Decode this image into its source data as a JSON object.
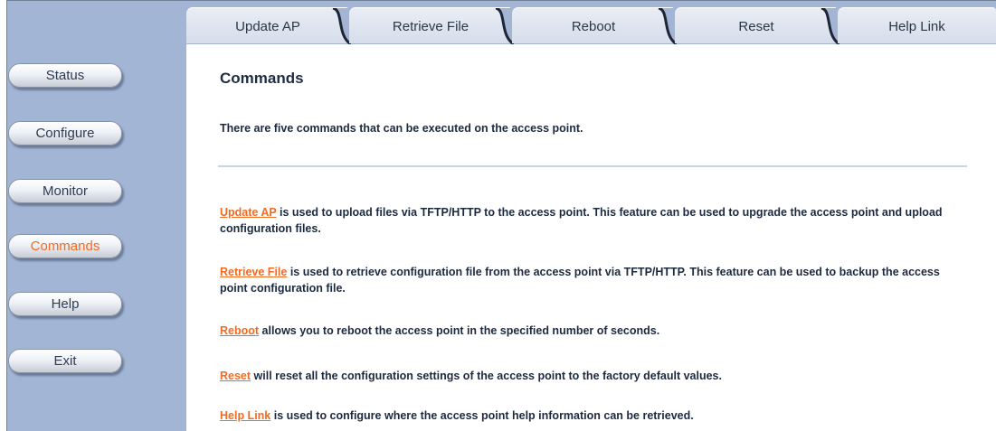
{
  "tabs": [
    {
      "label": "Update AP"
    },
    {
      "label": "Retrieve File"
    },
    {
      "label": "Reboot"
    },
    {
      "label": "Reset"
    },
    {
      "label": "Help Link"
    }
  ],
  "nav": [
    {
      "label": "Status",
      "active": false
    },
    {
      "label": "Configure",
      "active": false
    },
    {
      "label": "Monitor",
      "active": false
    },
    {
      "label": "Commands",
      "active": true
    },
    {
      "label": "Help",
      "active": false
    },
    {
      "label": "Exit",
      "active": false
    }
  ],
  "main": {
    "title": "Commands",
    "intro": "There are five commands that can be executed on the access point.",
    "items": [
      {
        "link": "Update AP",
        "text": " is used to upload files via TFTP/HTTP to the access point. This feature can be used to upgrade the access point and upload configuration files."
      },
      {
        "link": "Retrieve File",
        "text": " is used to retrieve configuration file from the access point via TFTP/HTTP. This feature can be used to backup the access point configuration file."
      },
      {
        "link": "Reboot",
        "text": " allows you to reboot the access point in the specified number of seconds."
      },
      {
        "link": "Reset",
        "text": " will reset all the configuration settings of the access point to the factory default values."
      },
      {
        "link": "Help Link",
        "text": " is used to configure where the access point help information can be retrieved."
      }
    ]
  },
  "colors": {
    "sidebar_bg": "#a2b5d5",
    "link_accent": "#f26b21",
    "heading_text": "#1f2d44"
  }
}
